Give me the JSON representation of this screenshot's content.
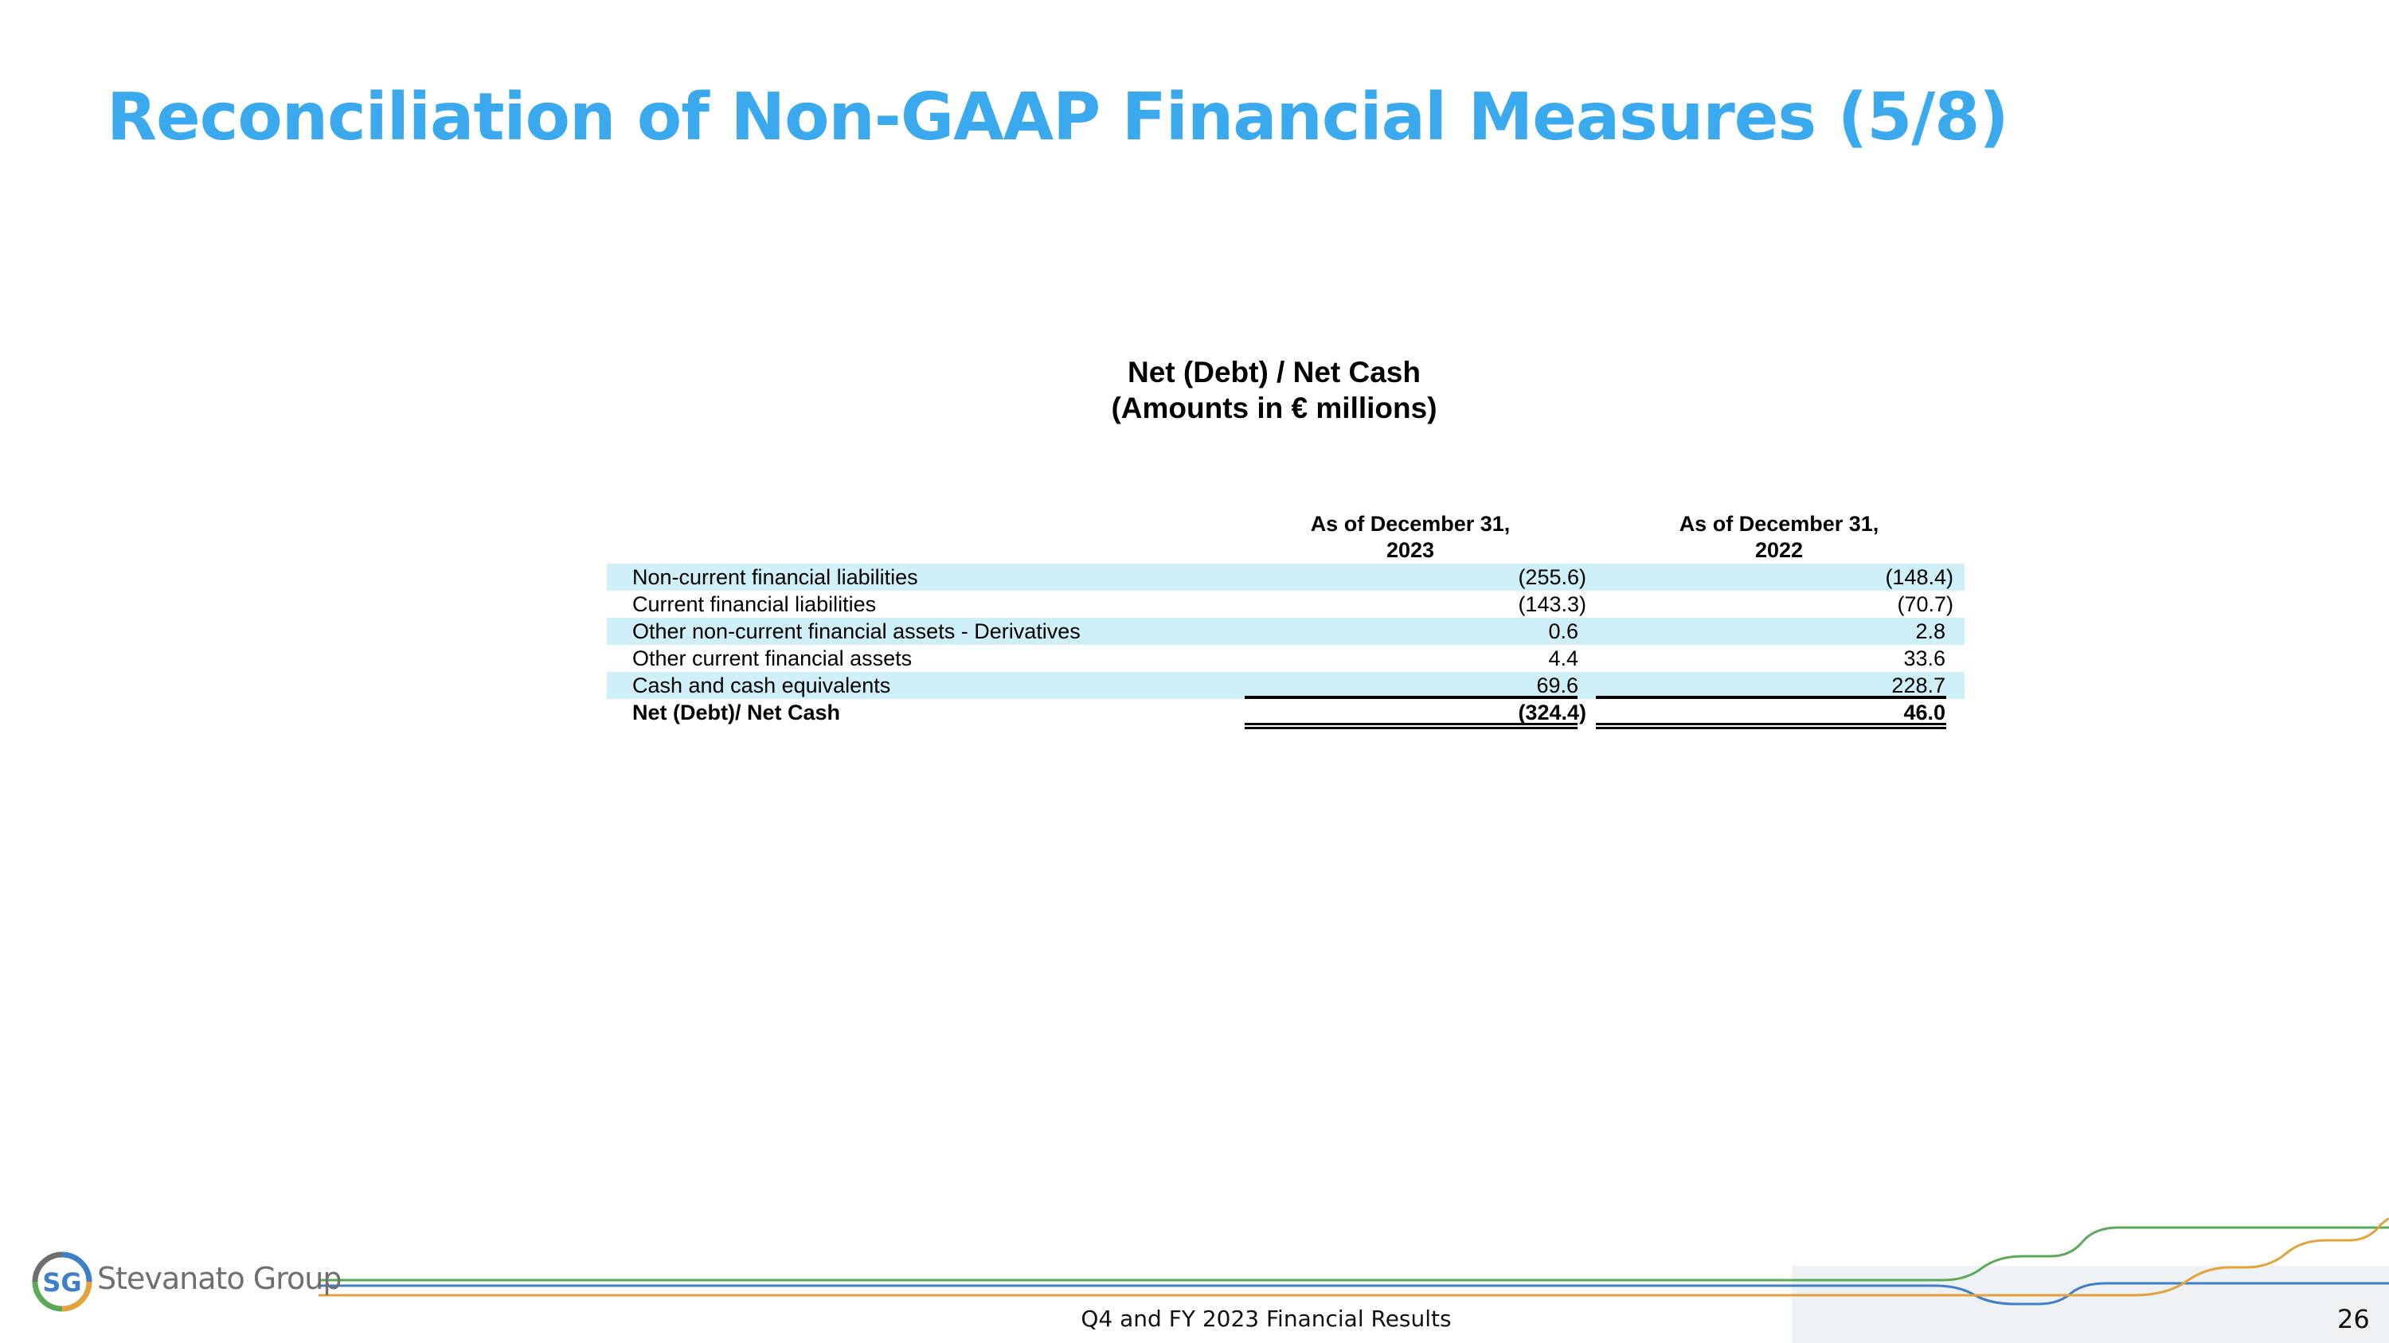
{
  "slide": {
    "title": "Reconciliation of Non-GAAP Financial Measures (5/8)",
    "footer_text": "Q4 and FY 2023 Financial Results",
    "page_number": "26"
  },
  "brand": {
    "name": "Stevanato Group",
    "logo_text": "SG"
  },
  "table": {
    "title": "Net (Debt) / Net Cash",
    "subtitle": "(Amounts in € millions)",
    "columns": [
      {
        "line1": "As of December 31,",
        "line2": "2023"
      },
      {
        "line1": "As of December 31,",
        "line2": "2022"
      }
    ],
    "rows": [
      {
        "label": "Non-current financial liabilities",
        "v2023": "(255.6)",
        "v2022": "(148.4)"
      },
      {
        "label": "Current financial liabilities",
        "v2023": "(143.3)",
        "v2022": "(70.7)"
      },
      {
        "label": "Other non-current financial assets - Derivatives",
        "v2023": "0.6",
        "v2022": "2.8"
      },
      {
        "label": "Other current financial assets",
        "v2023": "4.4",
        "v2022": "33.6"
      },
      {
        "label": "Cash and cash equivalents",
        "v2023": "69.6",
        "v2022": "228.7"
      },
      {
        "label": "Net (Debt)/ Net Cash",
        "v2023": "(324.4)",
        "v2022": "46.0"
      }
    ]
  },
  "colors": {
    "title_blue": "#3aa9ee",
    "row_shade": "#cfeff9",
    "line_green": "#5aaa5a",
    "line_blue": "#3f7fc8",
    "line_orange": "#e3a23a"
  }
}
